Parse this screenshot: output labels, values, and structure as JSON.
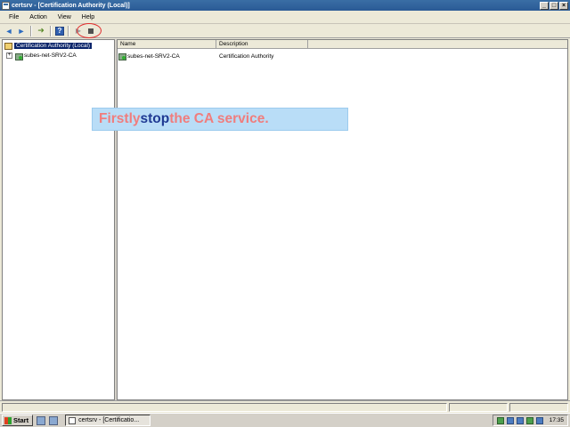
{
  "window": {
    "title": "certsrv - [Certification Authority (Local)]",
    "controls": {
      "minimize": "_",
      "restore": "□",
      "close": "×"
    }
  },
  "menubar": {
    "items": [
      "File",
      "Action",
      "View",
      "Help"
    ]
  },
  "toolbar": {
    "back": "◄",
    "forward": "►",
    "up": "➜",
    "help": "?",
    "start": "▶"
  },
  "tree": {
    "root_label": "Certification Authority (Local)",
    "child_label": "subes-net-SRV2-CA",
    "expander": "+"
  },
  "list": {
    "columns": [
      "Name",
      "Description"
    ],
    "rows": [
      {
        "name": "subes-net-SRV2-CA",
        "description": "Certification Authority"
      }
    ]
  },
  "callout": {
    "part1": "Firstly ",
    "part2": "stop",
    "part3": " the CA service."
  },
  "taskbar": {
    "start_label": "Start",
    "task_label": "certsrv - [Certificatio...",
    "clock": "17:35"
  },
  "colors": {
    "titlebar": "#3a6ea5",
    "highlight_ring": "#e03030",
    "callout_bg": "#b9ddf7",
    "callout_pink": "#f07d7d",
    "callout_blue": "#1f3a93"
  }
}
